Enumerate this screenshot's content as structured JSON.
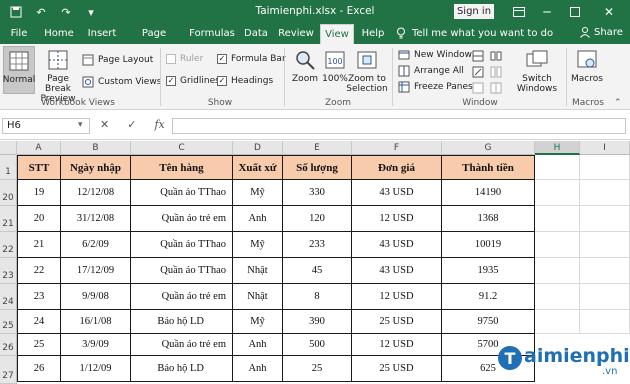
{
  "titlebar": {
    "title": "Taimienphi.xlsx  -  Excel",
    "signin": "Sign in",
    "qat_icons": [
      "save-icon",
      "undo-icon",
      "redo-icon",
      "customize-icon"
    ],
    "window_icons": [
      "ribbon-display-icon",
      "minimize-icon",
      "restore-icon",
      "close-icon"
    ]
  },
  "tabs": [
    "File",
    "Home",
    "Insert",
    "Page Layout",
    "Formulas",
    "Data",
    "Review",
    "View",
    "Help"
  ],
  "active_tab": "View",
  "tellme": "Tell me what you want to do",
  "share": "Share",
  "ribbon": {
    "workbook_views": {
      "normal": "Normal",
      "page_break_preview": "Page Break Preview",
      "page_layout": "Page Layout",
      "custom_views": "Custom Views",
      "label": "Workbook Views"
    },
    "show": {
      "ruler": "Ruler",
      "formula_bar": "Formula Bar",
      "gridlines": "Gridlines",
      "headings": "Headings",
      "label": "Show"
    },
    "zoom": {
      "zoom": "Zoom",
      "zoom100": "100%",
      "zoom_to_selection": "Zoom to Selection",
      "label": "Zoom"
    },
    "window": {
      "new_window": "New Window",
      "arrange_all": "Arrange All",
      "freeze_panes": "Freeze Panes",
      "switch_windows": "Switch Windows",
      "label": "Window"
    },
    "macros": {
      "macros": "Macros",
      "label": "Macros"
    }
  },
  "formula_bar": {
    "name_box": "H6",
    "cancel": "✕",
    "enter": "✓",
    "fx": "fx",
    "value": ""
  },
  "columns": [
    "A",
    "B",
    "C",
    "D",
    "E",
    "F",
    "G",
    "H",
    "I"
  ],
  "rows": [
    "1",
    "20",
    "21",
    "22",
    "23",
    "24",
    "25",
    "26",
    "27"
  ],
  "table": {
    "headers": [
      "STT",
      "Ngày nhập",
      "Tên hàng",
      "Xuất xứ",
      "Số lượng",
      "Đơn giá",
      "Thành tiền"
    ],
    "rows": [
      [
        "19",
        "12/12/08",
        "Quần áo TThao",
        "Mỹ",
        "330",
        "43 USD",
        "14190"
      ],
      [
        "20",
        "31/12/08",
        "Quần áo trẻ em",
        "Anh",
        "120",
        "12 USD",
        "1368"
      ],
      [
        "21",
        "6/2/09",
        "Quần áo TThao",
        "Mỹ",
        "233",
        "43 USD",
        "10019"
      ],
      [
        "22",
        "17/12/09",
        "Quần áo TThao",
        "Nhật",
        "45",
        "43 USD",
        "1935"
      ],
      [
        "23",
        "9/9/08",
        "Quần áo trẻ em",
        "Nhật",
        "8",
        "12 USD",
        "91.2"
      ],
      [
        "24",
        "16/1/08",
        "Bảo hộ LD",
        "Mỹ",
        "390",
        "25 USD",
        "9750"
      ],
      [
        "25",
        "3/9/09",
        "Quần áo trẻ em",
        "Anh",
        "500",
        "12 USD",
        "5700"
      ],
      [
        "26",
        "1/12/09",
        "Bảo hộ LD",
        "Anh",
        "25",
        "25 USD",
        "625"
      ]
    ]
  },
  "watermark": {
    "brand": "aimienphi",
    "suffix": ".vn"
  },
  "colors": {
    "excel_green": "#217346",
    "header_fill": "#f8cbad"
  }
}
